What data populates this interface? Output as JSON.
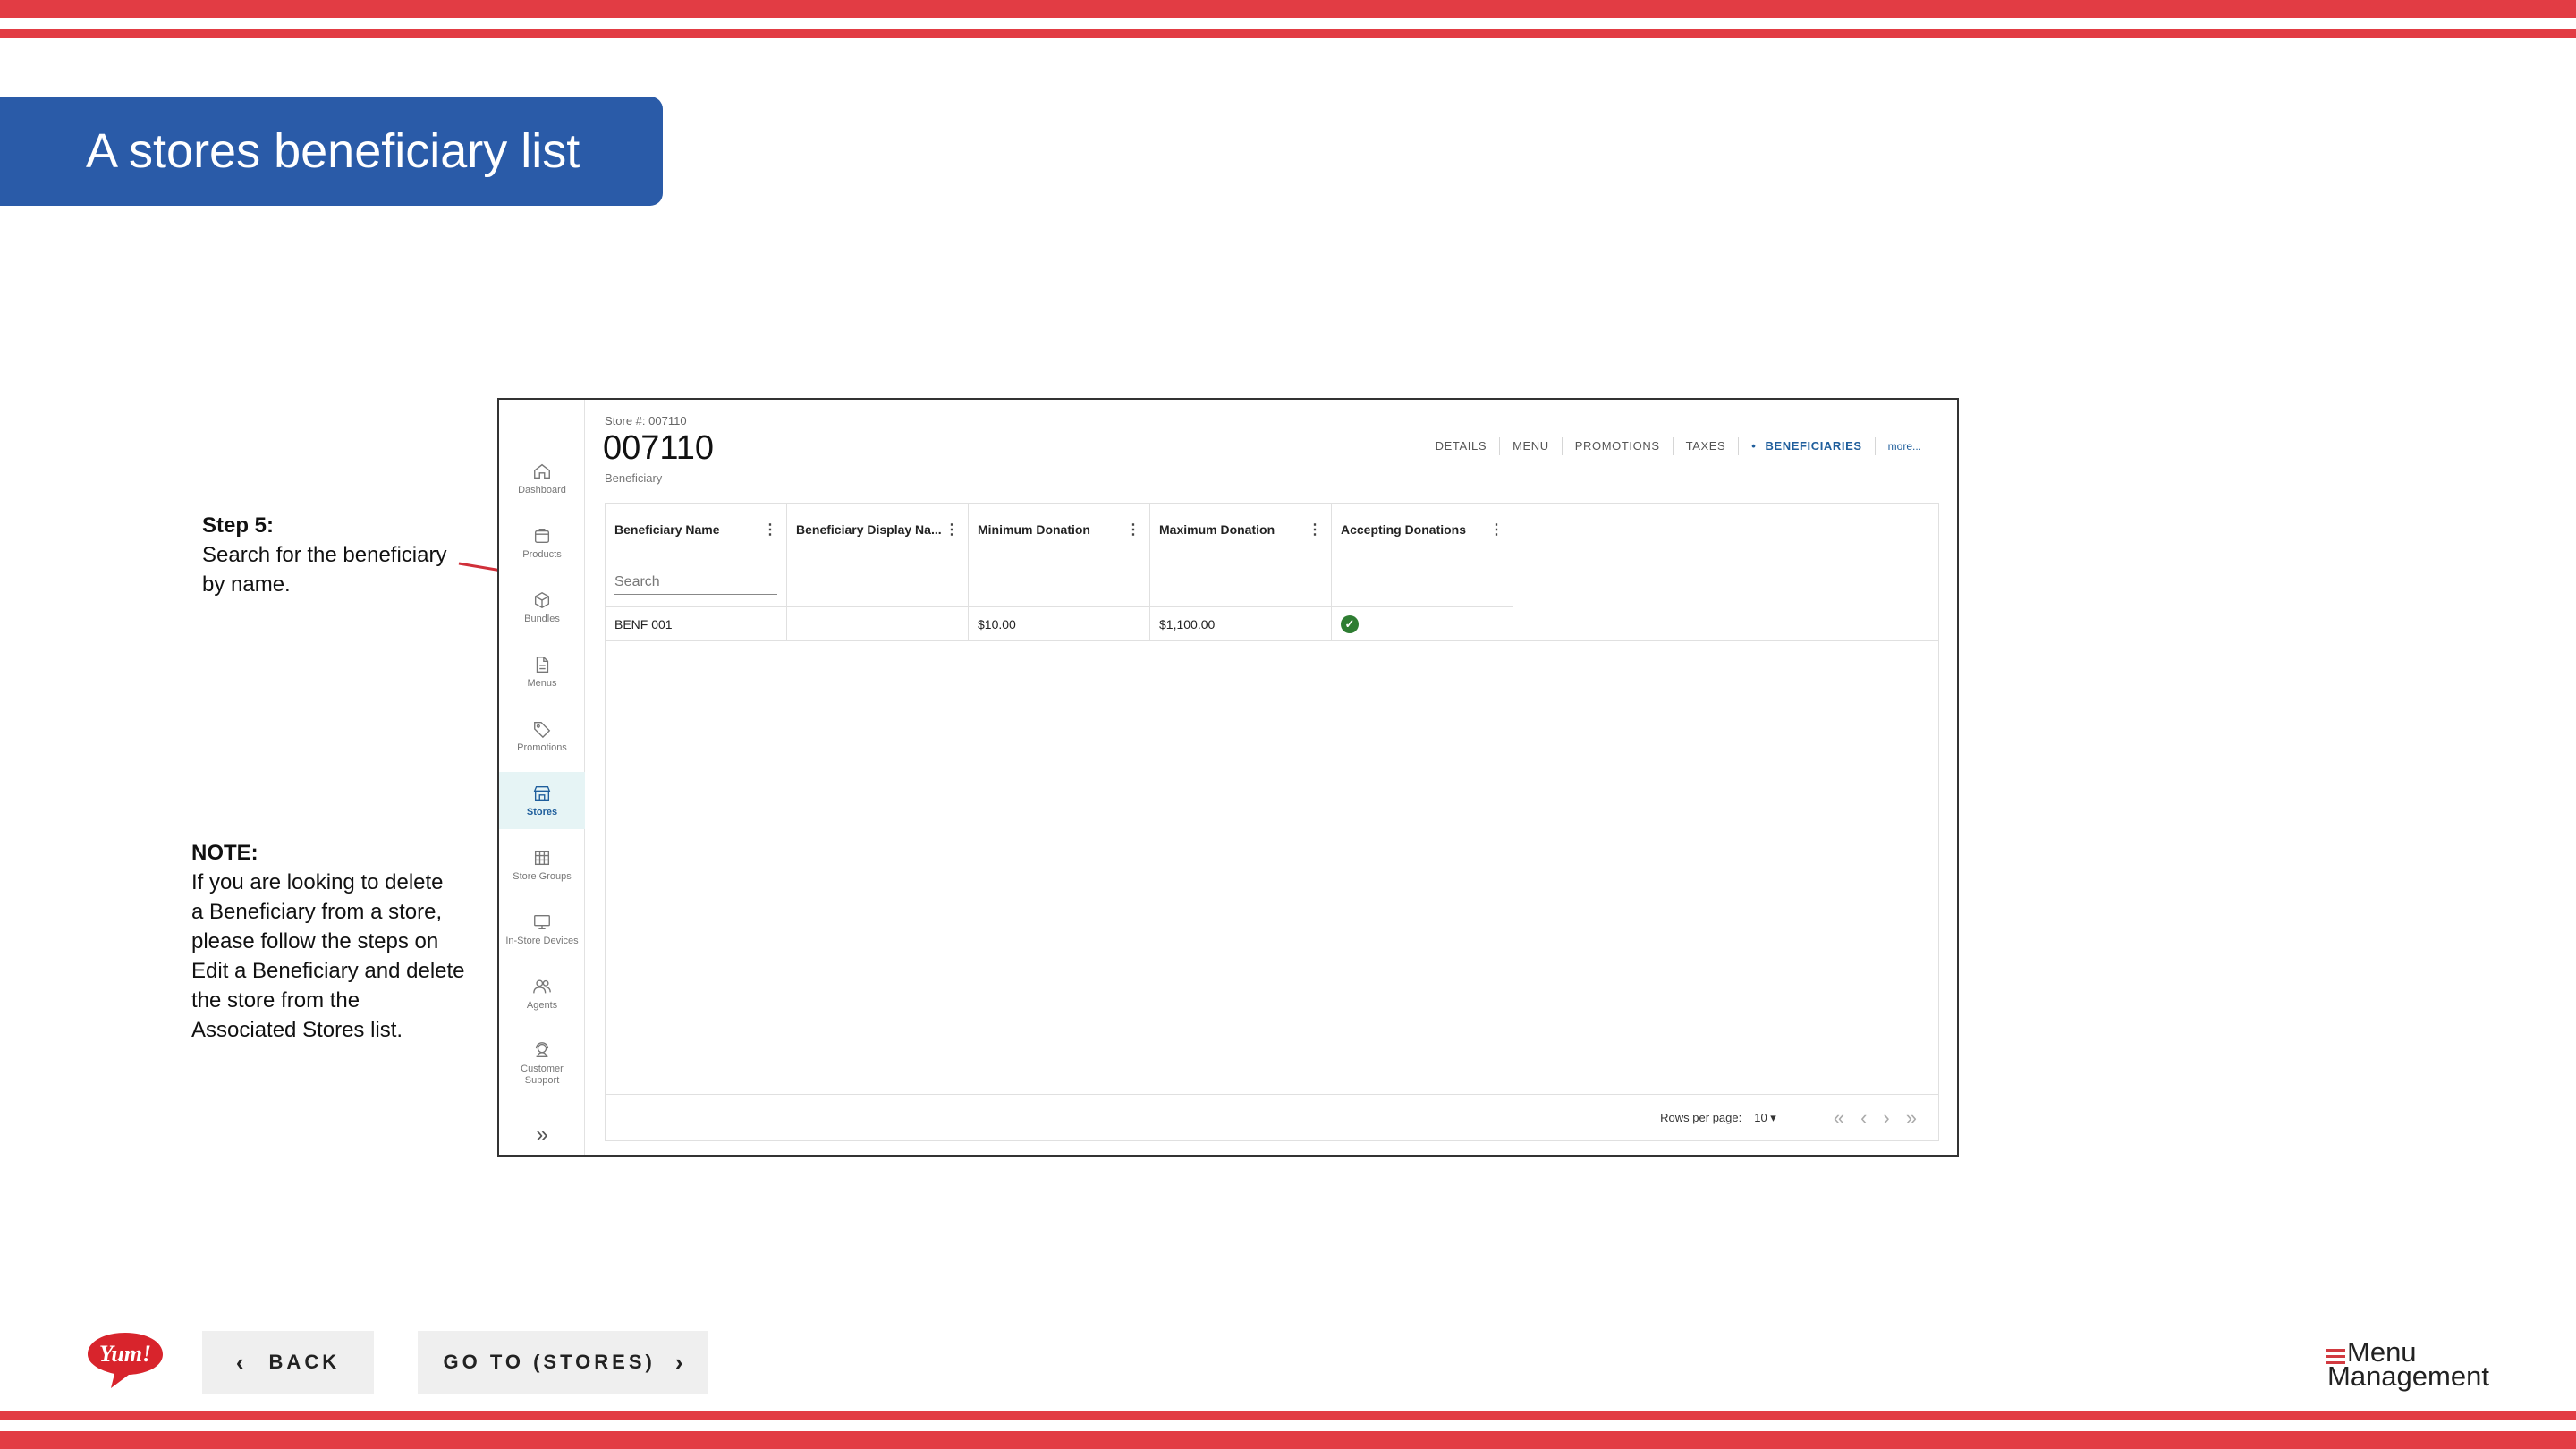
{
  "slide": {
    "title": "A stores beneficiary list",
    "step": {
      "heading": "Step 5:",
      "lines": [
        "Search for the beneficiary",
        "by name."
      ]
    },
    "note": {
      "heading": "NOTE:",
      "lines": [
        "If you are looking to delete",
        "a Beneficiary from a store,",
        "please follow the steps on",
        "Edit a Beneficiary and delete",
        "the store from the",
        "Associated Stores list."
      ]
    },
    "colors": {
      "stripe": "#e23c44",
      "banner": "#2a5ba8"
    }
  },
  "app": {
    "sidebar": [
      {
        "label": "Dashboard",
        "icon": "home-icon"
      },
      {
        "label": "Products",
        "icon": "box-icon"
      },
      {
        "label": "Bundles",
        "icon": "cube-icon"
      },
      {
        "label": "Menus",
        "icon": "document-icon"
      },
      {
        "label": "Promotions",
        "icon": "tag-icon"
      },
      {
        "label": "Stores",
        "icon": "store-icon",
        "active": true
      },
      {
        "label": "Store Groups",
        "icon": "grid-icon"
      },
      {
        "label": "In-Store Devices",
        "icon": "monitor-icon"
      },
      {
        "label": "Agents",
        "icon": "users-icon"
      },
      {
        "label": "Customer Support",
        "icon": "headset-icon",
        "label_lines": [
          "Customer",
          "Support"
        ]
      }
    ],
    "collapse_glyph": "»",
    "store_number": "Store #: 007110",
    "store_title": "007110",
    "store_subtitle": "Beneficiary",
    "tabs": [
      "DETAILS",
      "MENU",
      "PROMOTIONS",
      "TAXES",
      "BENEFICIARIES"
    ],
    "active_tab": "BENEFICIARIES",
    "more_label": "more...",
    "table": {
      "columns": [
        "Beneficiary Name",
        "Beneficiary Display Na...",
        "Minimum Donation",
        "Maximum Donation",
        "Accepting Donations"
      ],
      "search_placeholder": "Search",
      "rows": [
        {
          "name": "BENF 001",
          "display_name": "",
          "min": "$10.00",
          "max": "$1,100.00",
          "accepting": true
        }
      ]
    },
    "pager": {
      "rows_per_page_label": "Rows per page:",
      "rows_per_page_value": "10 ▾",
      "first": "«",
      "prev": "‹",
      "next": "›",
      "last": "»"
    }
  },
  "footer": {
    "back_label": "BACK",
    "back_chevron": "‹",
    "goto_label": "GO TO (STORES)",
    "goto_chevron": "›",
    "brand_logo_text": "Yum!",
    "product_logo": {
      "line1": "Menu",
      "line2": "Management"
    }
  }
}
